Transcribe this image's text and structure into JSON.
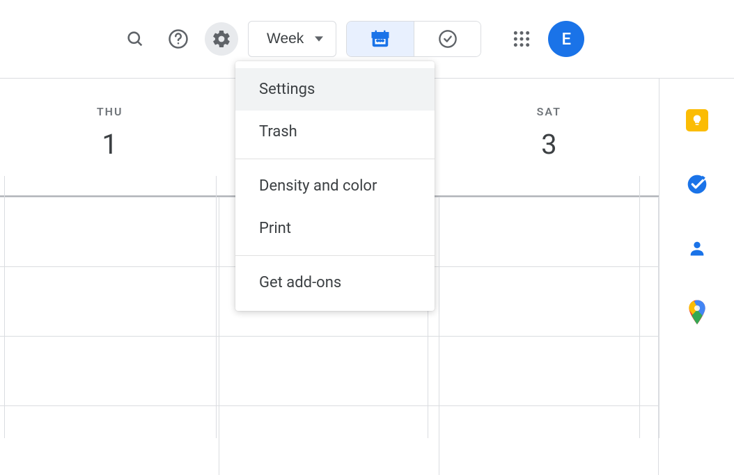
{
  "topbar": {
    "view_label": "Week",
    "avatar_letter": "E"
  },
  "menu": {
    "settings": "Settings",
    "trash": "Trash",
    "density": "Density and color",
    "print": "Print",
    "addons": "Get add-ons"
  },
  "days": [
    {
      "name": "THU",
      "num": "1"
    },
    {
      "name": "",
      "num": ""
    },
    {
      "name": "SAT",
      "num": "3"
    }
  ]
}
